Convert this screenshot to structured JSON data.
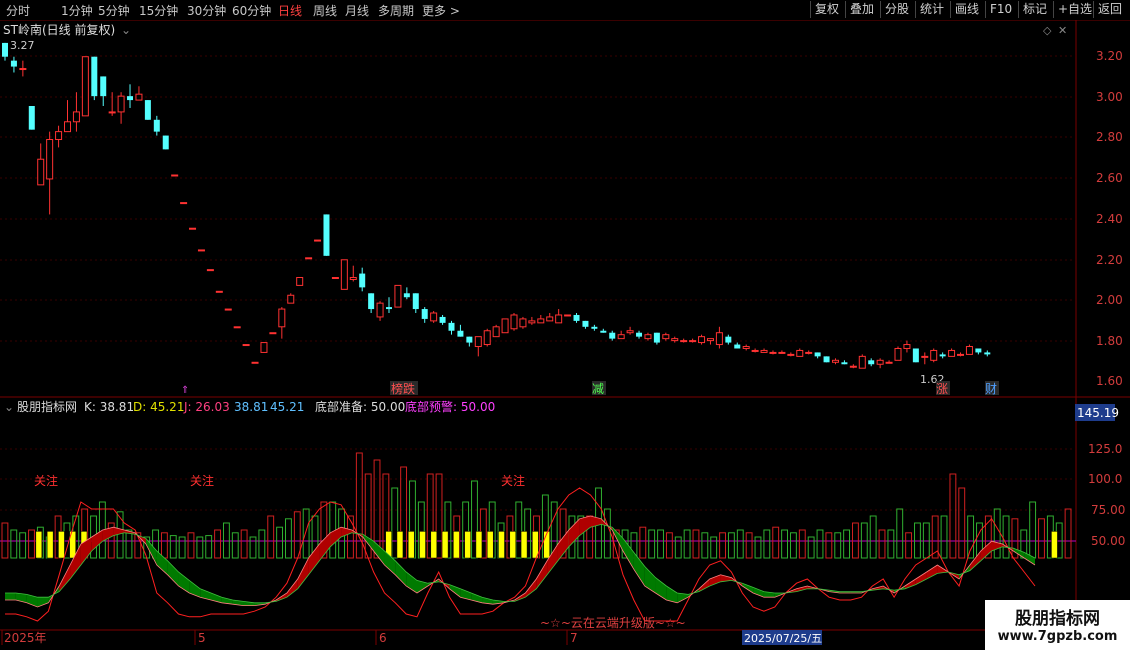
{
  "toolbar": {
    "periods": [
      "分时",
      "1分钟",
      "5分钟",
      "15分钟",
      "30分钟",
      "60分钟",
      "日线",
      "周线",
      "月线",
      "多周期",
      "更多 >"
    ],
    "active_period": "日线",
    "actions": [
      "复权",
      "叠加",
      "分股",
      "统计",
      "画线",
      "F10",
      "标记",
      "+自选",
      "返回"
    ]
  },
  "price_panel": {
    "title": "ST岭南(日线 前复权)",
    "high_marker": "3.27",
    "low_marker": "1.62",
    "y_ticks": [
      "3.20",
      "3.00",
      "2.80",
      "2.60",
      "2.40",
      "2.20",
      "2.00",
      "1.80",
      "1.60"
    ],
    "events": [
      "榜跌",
      "减",
      "涨",
      "财"
    ]
  },
  "indicator_panel": {
    "name": "股朋指标网",
    "k_label": "K: 38.81",
    "d_label": "D: 45.21",
    "j_label": "J: 26.03",
    "v1": "38.81",
    "v2": "45.21",
    "prep_label": "底部准备: 50.00",
    "warn_label": "底部预警: 50.00",
    "y_ticks": [
      "125.0",
      "100.0",
      "75.00",
      "50.00"
    ],
    "current_value": "145.19",
    "tags": [
      "关注",
      "关注",
      "关注"
    ],
    "footer_text": "~☆~云在云端升级版~☆~"
  },
  "time_axis": {
    "labels": [
      "2025年",
      "5",
      "6",
      "7"
    ],
    "cursor_date": "2025/07/25/五"
  },
  "watermark": {
    "site": "股朋指标网",
    "url": "www.7gpzb.com"
  },
  "colors": {
    "up": "#ff3232",
    "down": "#54ffff",
    "bg": "#000000",
    "grid": "#3a0000",
    "ma_red": "#b00000",
    "ma_green": "#007a00"
  },
  "chart_data": {
    "type": "candlestick",
    "ylim": [
      1.55,
      3.3
    ],
    "candles": [
      {
        "o": 3.27,
        "c": 3.2,
        "h": 3.27,
        "l": 3.18
      },
      {
        "o": 3.18,
        "c": 3.15,
        "h": 3.2,
        "l": 3.12
      },
      {
        "o": 3.14,
        "c": 3.14,
        "h": 3.18,
        "l": 3.1
      },
      {
        "o": 2.95,
        "c": 2.83,
        "h": 2.95,
        "l": 2.83
      },
      {
        "o": 2.55,
        "c": 2.68,
        "h": 2.76,
        "l": 2.55
      },
      {
        "o": 2.58,
        "c": 2.78,
        "h": 2.82,
        "l": 2.4
      },
      {
        "o": 2.78,
        "c": 2.82,
        "h": 2.85,
        "l": 2.74
      },
      {
        "o": 2.82,
        "c": 2.87,
        "h": 2.98,
        "l": 2.82
      },
      {
        "o": 2.87,
        "c": 2.92,
        "h": 3.02,
        "l": 2.82
      },
      {
        "o": 2.9,
        "c": 3.2,
        "h": 3.2,
        "l": 2.9
      },
      {
        "o": 3.2,
        "c": 3.0,
        "h": 3.2,
        "l": 2.98
      },
      {
        "o": 3.1,
        "c": 3.0,
        "h": 3.1,
        "l": 2.95
      },
      {
        "o": 2.92,
        "c": 2.92,
        "h": 3.02,
        "l": 2.9
      },
      {
        "o": 2.92,
        "c": 3.0,
        "h": 3.02,
        "l": 2.86
      },
      {
        "o": 3.0,
        "c": 2.98,
        "h": 3.06,
        "l": 2.94
      },
      {
        "o": 2.98,
        "c": 3.01,
        "h": 3.05,
        "l": 2.98
      },
      {
        "o": 2.98,
        "c": 2.88,
        "h": 2.98,
        "l": 2.88
      },
      {
        "o": 2.88,
        "c": 2.82,
        "h": 2.9,
        "l": 2.8
      },
      {
        "o": 2.8,
        "c": 2.73,
        "h": 2.8,
        "l": 2.73
      },
      {
        "o": 2.6,
        "c": 2.6,
        "h": 2.6,
        "l": 2.6
      },
      {
        "o": 2.46,
        "c": 2.46,
        "h": 2.46,
        "l": 2.46
      },
      {
        "o": 2.33,
        "c": 2.33,
        "h": 2.33,
        "l": 2.33
      },
      {
        "o": 2.22,
        "c": 2.22,
        "h": 2.22,
        "l": 2.22
      },
      {
        "o": 2.12,
        "c": 2.12,
        "h": 2.12,
        "l": 2.12
      },
      {
        "o": 2.01,
        "c": 2.01,
        "h": 2.01,
        "l": 2.01
      },
      {
        "o": 1.92,
        "c": 1.92,
        "h": 1.92,
        "l": 1.92
      },
      {
        "o": 1.83,
        "c": 1.83,
        "h": 1.83,
        "l": 1.83
      },
      {
        "o": 1.74,
        "c": 1.74,
        "h": 1.74,
        "l": 1.74
      },
      {
        "o": 1.65,
        "c": 1.65,
        "h": 1.65,
        "l": 1.65
      },
      {
        "o": 1.7,
        "c": 1.75,
        "h": 1.75,
        "l": 1.7
      },
      {
        "o": 1.8,
        "c": 1.8,
        "h": 1.8,
        "l": 1.8
      },
      {
        "o": 1.83,
        "c": 1.92,
        "h": 1.93,
        "l": 1.77
      },
      {
        "o": 1.95,
        "c": 1.99,
        "h": 2.0,
        "l": 1.95
      },
      {
        "o": 2.04,
        "c": 2.08,
        "h": 2.08,
        "l": 2.04
      },
      {
        "o": 2.18,
        "c": 2.18,
        "h": 2.18,
        "l": 2.18
      },
      {
        "o": 2.27,
        "c": 2.27,
        "h": 2.27,
        "l": 2.27
      },
      {
        "o": 2.4,
        "c": 2.19,
        "h": 2.4,
        "l": 2.19
      },
      {
        "o": 2.08,
        "c": 2.08,
        "h": 2.08,
        "l": 2.08
      },
      {
        "o": 2.02,
        "c": 2.17,
        "h": 2.17,
        "l": 2.02
      },
      {
        "o": 2.07,
        "c": 2.08,
        "h": 2.14,
        "l": 2.06
      },
      {
        "o": 2.1,
        "c": 2.03,
        "h": 2.13,
        "l": 2.01
      },
      {
        "o": 2.0,
        "c": 1.92,
        "h": 2.0,
        "l": 1.9
      },
      {
        "o": 1.88,
        "c": 1.95,
        "h": 1.96,
        "l": 1.86
      },
      {
        "o": 1.93,
        "c": 1.92,
        "h": 1.98,
        "l": 1.9
      },
      {
        "o": 1.93,
        "c": 2.04,
        "h": 2.04,
        "l": 1.93
      },
      {
        "o": 2.0,
        "c": 1.98,
        "h": 2.03,
        "l": 1.97
      },
      {
        "o": 2.0,
        "c": 1.92,
        "h": 2.0,
        "l": 1.9
      },
      {
        "o": 1.92,
        "c": 1.87,
        "h": 1.93,
        "l": 1.85
      },
      {
        "o": 1.86,
        "c": 1.9,
        "h": 1.91,
        "l": 1.85
      },
      {
        "o": 1.88,
        "c": 1.85,
        "h": 1.89,
        "l": 1.84
      },
      {
        "o": 1.85,
        "c": 1.81,
        "h": 1.86,
        "l": 1.79
      },
      {
        "o": 1.81,
        "c": 1.78,
        "h": 1.84,
        "l": 1.78
      },
      {
        "o": 1.78,
        "c": 1.75,
        "h": 1.78,
        "l": 1.73
      },
      {
        "o": 1.73,
        "c": 1.78,
        "h": 1.78,
        "l": 1.68
      },
      {
        "o": 1.74,
        "c": 1.81,
        "h": 1.82,
        "l": 1.73
      },
      {
        "o": 1.78,
        "c": 1.83,
        "h": 1.84,
        "l": 1.78
      },
      {
        "o": 1.8,
        "c": 1.87,
        "h": 1.87,
        "l": 1.8
      },
      {
        "o": 1.82,
        "c": 1.89,
        "h": 1.9,
        "l": 1.81
      },
      {
        "o": 1.83,
        "c": 1.87,
        "h": 1.88,
        "l": 1.82
      },
      {
        "o": 1.85,
        "c": 1.86,
        "h": 1.88,
        "l": 1.84
      },
      {
        "o": 1.85,
        "c": 1.87,
        "h": 1.89,
        "l": 1.85
      },
      {
        "o": 1.86,
        "c": 1.88,
        "h": 1.9,
        "l": 1.86
      },
      {
        "o": 1.85,
        "c": 1.89,
        "h": 1.92,
        "l": 1.85
      },
      {
        "o": 1.89,
        "c": 1.89,
        "h": 1.89,
        "l": 1.89
      },
      {
        "o": 1.89,
        "c": 1.86,
        "h": 1.9,
        "l": 1.85
      },
      {
        "o": 1.86,
        "c": 1.83,
        "h": 1.86,
        "l": 1.82
      },
      {
        "o": 1.83,
        "c": 1.82,
        "h": 1.84,
        "l": 1.81
      },
      {
        "o": 1.81,
        "c": 1.8,
        "h": 1.82,
        "l": 1.8
      },
      {
        "o": 1.8,
        "c": 1.77,
        "h": 1.81,
        "l": 1.76
      },
      {
        "o": 1.77,
        "c": 1.79,
        "h": 1.81,
        "l": 1.77
      },
      {
        "o": 1.8,
        "c": 1.81,
        "h": 1.83,
        "l": 1.79
      },
      {
        "o": 1.8,
        "c": 1.78,
        "h": 1.81,
        "l": 1.77
      },
      {
        "o": 1.77,
        "c": 1.79,
        "h": 1.8,
        "l": 1.76
      },
      {
        "o": 1.8,
        "c": 1.75,
        "h": 1.8,
        "l": 1.74
      },
      {
        "o": 1.77,
        "c": 1.79,
        "h": 1.8,
        "l": 1.76
      },
      {
        "o": 1.76,
        "c": 1.77,
        "h": 1.78,
        "l": 1.75
      },
      {
        "o": 1.76,
        "c": 1.76,
        "h": 1.77,
        "l": 1.75
      },
      {
        "o": 1.76,
        "c": 1.76,
        "h": 1.77,
        "l": 1.75
      },
      {
        "o": 1.75,
        "c": 1.78,
        "h": 1.79,
        "l": 1.74
      },
      {
        "o": 1.76,
        "c": 1.77,
        "h": 1.77,
        "l": 1.74
      },
      {
        "o": 1.74,
        "c": 1.8,
        "h": 1.83,
        "l": 1.72
      },
      {
        "o": 1.78,
        "c": 1.75,
        "h": 1.79,
        "l": 1.74
      },
      {
        "o": 1.74,
        "c": 1.72,
        "h": 1.75,
        "l": 1.72
      },
      {
        "o": 1.72,
        "c": 1.73,
        "h": 1.74,
        "l": 1.71
      },
      {
        "o": 1.71,
        "c": 1.71,
        "h": 1.72,
        "l": 1.7
      },
      {
        "o": 1.7,
        "c": 1.71,
        "h": 1.72,
        "l": 1.7
      },
      {
        "o": 1.7,
        "c": 1.7,
        "h": 1.71,
        "l": 1.69
      },
      {
        "o": 1.7,
        "c": 1.7,
        "h": 1.71,
        "l": 1.7
      },
      {
        "o": 1.69,
        "c": 1.69,
        "h": 1.7,
        "l": 1.68
      },
      {
        "o": 1.68,
        "c": 1.71,
        "h": 1.72,
        "l": 1.68
      },
      {
        "o": 1.7,
        "c": 1.7,
        "h": 1.71,
        "l": 1.69
      },
      {
        "o": 1.7,
        "c": 1.68,
        "h": 1.7,
        "l": 1.67
      },
      {
        "o": 1.68,
        "c": 1.65,
        "h": 1.68,
        "l": 1.65
      },
      {
        "o": 1.65,
        "c": 1.66,
        "h": 1.67,
        "l": 1.64
      },
      {
        "o": 1.65,
        "c": 1.64,
        "h": 1.66,
        "l": 1.64
      },
      {
        "o": 1.63,
        "c": 1.63,
        "h": 1.64,
        "l": 1.62
      },
      {
        "o": 1.62,
        "c": 1.68,
        "h": 1.69,
        "l": 1.62
      },
      {
        "o": 1.66,
        "c": 1.64,
        "h": 1.67,
        "l": 1.63
      },
      {
        "o": 1.64,
        "c": 1.66,
        "h": 1.67,
        "l": 1.62
      },
      {
        "o": 1.65,
        "c": 1.65,
        "h": 1.66,
        "l": 1.65
      },
      {
        "o": 1.66,
        "c": 1.72,
        "h": 1.73,
        "l": 1.66
      },
      {
        "o": 1.72,
        "c": 1.74,
        "h": 1.76,
        "l": 1.7
      },
      {
        "o": 1.72,
        "c": 1.65,
        "h": 1.72,
        "l": 1.65
      },
      {
        "o": 1.68,
        "c": 1.68,
        "h": 1.7,
        "l": 1.64
      },
      {
        "o": 1.66,
        "c": 1.71,
        "h": 1.72,
        "l": 1.65
      },
      {
        "o": 1.69,
        "c": 1.68,
        "h": 1.7,
        "l": 1.67
      },
      {
        "o": 1.68,
        "c": 1.71,
        "h": 1.72,
        "l": 1.68
      },
      {
        "o": 1.69,
        "c": 1.69,
        "h": 1.7,
        "l": 1.68
      },
      {
        "o": 1.69,
        "c": 1.73,
        "h": 1.74,
        "l": 1.69
      },
      {
        "o": 1.72,
        "c": 1.7,
        "h": 1.72,
        "l": 1.69
      },
      {
        "o": 1.7,
        "c": 1.69,
        "h": 1.71,
        "l": 1.68
      }
    ],
    "indicator": {
      "ylim": [
        0,
        150
      ],
      "base": 50,
      "volume": [
        25,
        20,
        18,
        20,
        22,
        15,
        30,
        25,
        30,
        35,
        30,
        40,
        25,
        33,
        20,
        18,
        15,
        20,
        18,
        16,
        15,
        18,
        15,
        16,
        20,
        25,
        18,
        20,
        15,
        20,
        30,
        22,
        28,
        33,
        35,
        30,
        40,
        40,
        35,
        30,
        75,
        60,
        70,
        60,
        50,
        65,
        55,
        40,
        60,
        60,
        40,
        30,
        40,
        55,
        35,
        40,
        25,
        30,
        40,
        35,
        30,
        45,
        40,
        35,
        30,
        30,
        30,
        50,
        35,
        20,
        20,
        18,
        22,
        20,
        20,
        18,
        15,
        20,
        20,
        18,
        15,
        18,
        18,
        20,
        18,
        15,
        20,
        22,
        20,
        18,
        20,
        15,
        20,
        18,
        18,
        20,
        25,
        25,
        30,
        20,
        20,
        35,
        18,
        25,
        25,
        30,
        30,
        60,
        50,
        30,
        25,
        30,
        35,
        30,
        28,
        20,
        40,
        28,
        30,
        25,
        35
      ],
      "sig_a": [
        0,
        0,
        0,
        75,
        75,
        75,
        75,
        75,
        0,
        0,
        0,
        0,
        0,
        0,
        0,
        0,
        0,
        0,
        0,
        0,
        0,
        0,
        0,
        0,
        0,
        0,
        0,
        0,
        0,
        0,
        0,
        0,
        0,
        0,
        75,
        75,
        75,
        75,
        75,
        75,
        75,
        75,
        75,
        75,
        75,
        75,
        75,
        75,
        75,
        0,
        0,
        0,
        0,
        0,
        0,
        0,
        0,
        0,
        0,
        0,
        0,
        0,
        0,
        0,
        0,
        0,
        0,
        0,
        0,
        0,
        0,
        0,
        0,
        0,
        0,
        0,
        0,
        0,
        0,
        0,
        0,
        0,
        0,
        0,
        0,
        0,
        0,
        0,
        0,
        0,
        0,
        0,
        0,
        75,
        0
      ],
      "k": [
        20,
        20,
        18,
        15,
        18,
        30,
        45,
        60,
        65,
        70,
        72,
        70,
        68,
        60,
        45,
        38,
        30,
        25,
        22,
        20,
        18,
        17,
        16,
        16,
        17,
        20,
        25,
        35,
        50,
        60,
        68,
        72,
        70,
        65,
        55,
        45,
        38,
        30,
        25,
        30,
        35,
        28,
        22,
        20,
        18,
        17,
        18,
        20,
        25,
        35,
        48,
        60,
        70,
        78,
        80,
        78,
        70,
        55,
        42,
        30,
        25,
        20,
        18,
        22,
        28,
        35,
        38,
        36,
        30,
        25,
        22,
        22,
        25,
        28,
        30,
        28,
        26,
        25,
        25,
        25,
        28,
        30,
        25,
        30,
        35,
        40,
        45,
        40,
        35,
        45,
        55,
        62,
        60,
        55,
        50,
        45
      ],
      "d": [
        25,
        25,
        24,
        22,
        22,
        26,
        35,
        45,
        55,
        62,
        66,
        68,
        67,
        64,
        55,
        48,
        40,
        34,
        28,
        25,
        22,
        20,
        19,
        18,
        18,
        19,
        22,
        28,
        38,
        48,
        58,
        65,
        68,
        67,
        62,
        55,
        48,
        40,
        34,
        32,
        33,
        31,
        28,
        25,
        22,
        20,
        19,
        19,
        22,
        28,
        38,
        48,
        58,
        66,
        72,
        74,
        72,
        64,
        54,
        44,
        36,
        30,
        25,
        24,
        26,
        30,
        33,
        34,
        32,
        29,
        26,
        25,
        25,
        26,
        28,
        28,
        27,
        26,
        26,
        26,
        27,
        28,
        27,
        28,
        31,
        35,
        39,
        40,
        38,
        41,
        48,
        55,
        58,
        57,
        54,
        50
      ],
      "j": [
        10,
        10,
        8,
        5,
        12,
        38,
        65,
        90,
        85,
        85,
        85,
        75,
        70,
        52,
        25,
        18,
        10,
        8,
        8,
        10,
        10,
        10,
        10,
        12,
        15,
        22,
        32,
        50,
        75,
        85,
        90,
        88,
        75,
        60,
        40,
        25,
        18,
        10,
        8,
        25,
        40,
        22,
        10,
        10,
        10,
        12,
        18,
        22,
        30,
        50,
        68,
        85,
        95,
        100,
        95,
        85,
        65,
        38,
        20,
        5,
        5,
        5,
        5,
        20,
        35,
        45,
        48,
        40,
        25,
        15,
        12,
        15,
        25,
        32,
        35,
        28,
        22,
        20,
        20,
        22,
        30,
        35,
        22,
        35,
        45,
        50,
        55,
        40,
        30,
        55,
        70,
        78,
        65,
        50,
        40,
        30
      ]
    }
  }
}
